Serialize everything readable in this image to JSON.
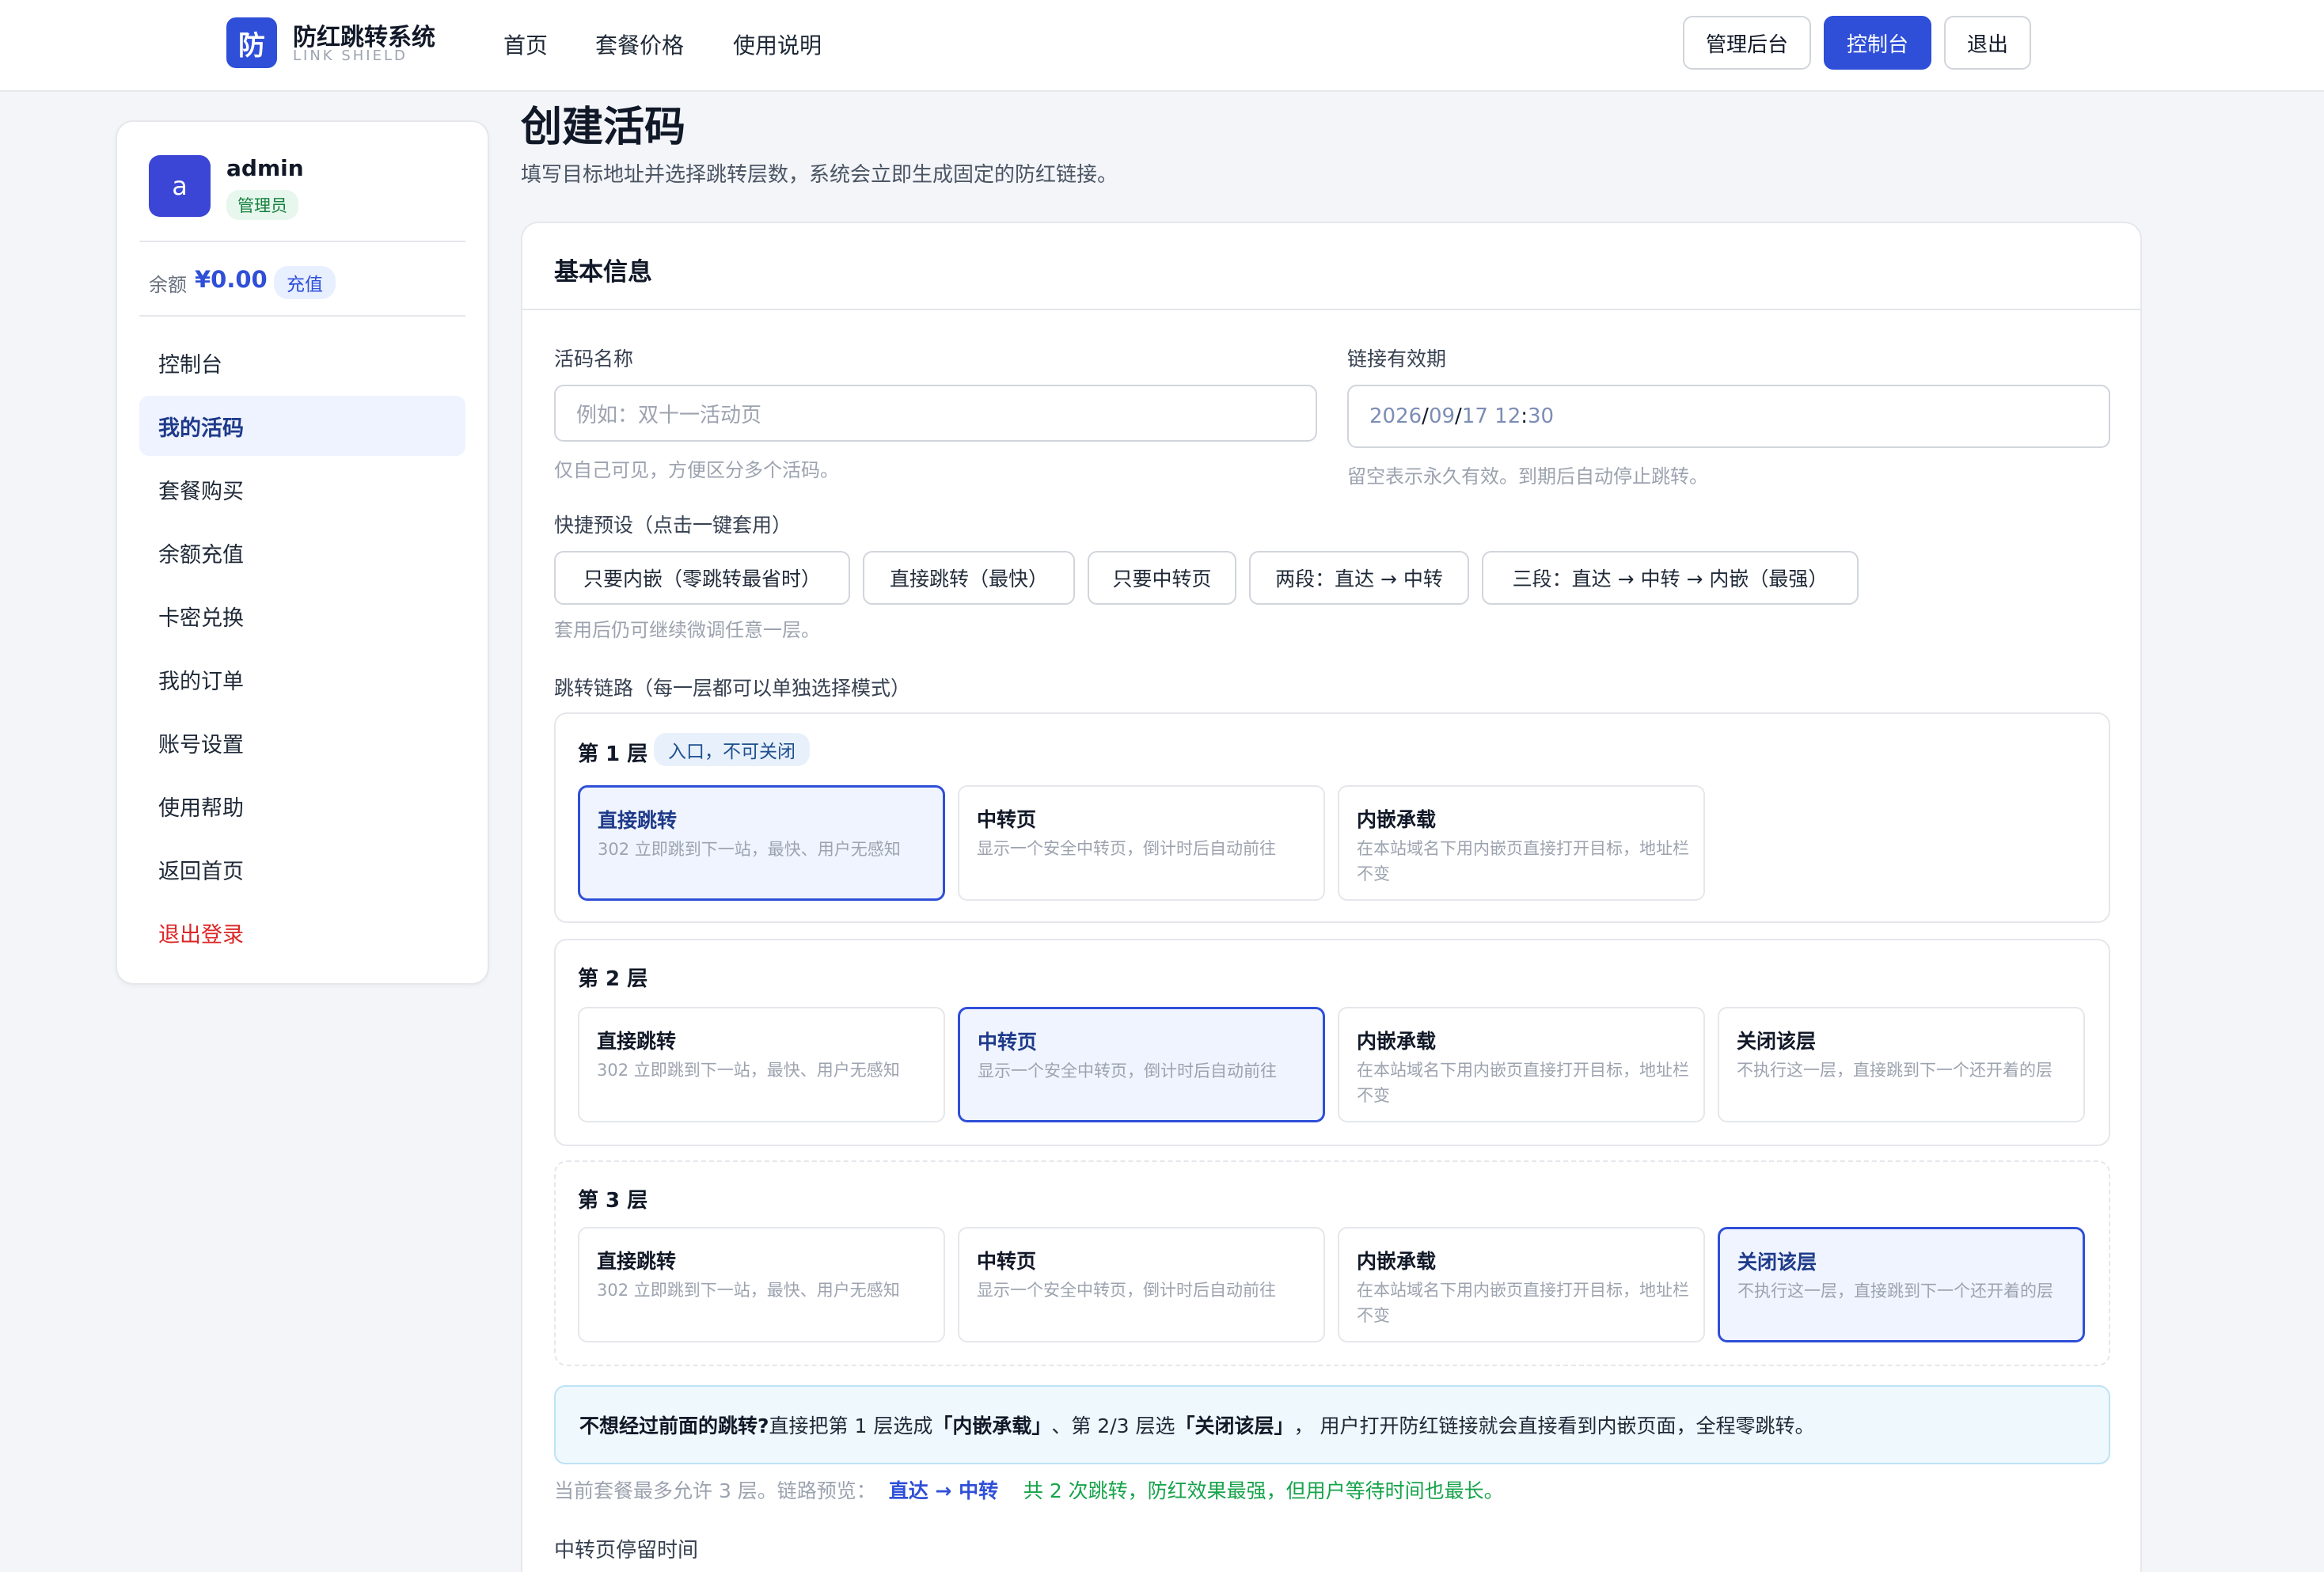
{
  "header": {
    "logo_char": "防",
    "brand_name": "防红跳转系统",
    "brand_sub": "LINK SHIELD",
    "nav": [
      "首页",
      "套餐价格",
      "使用说明"
    ],
    "btn_admin": "管理后台",
    "btn_console": "控制台",
    "btn_logout": "退出"
  },
  "sidebar": {
    "avatar_char": "a",
    "user_name": "admin",
    "role": "管理员",
    "balance_label": "余额",
    "balance_amount": "¥0.00",
    "recharge": "充值",
    "items": [
      "控制台",
      "我的活码",
      "套餐购买",
      "余额充值",
      "卡密兑换",
      "我的订单",
      "账号设置",
      "使用帮助",
      "返回首页",
      "退出登录"
    ]
  },
  "main": {
    "title": "创建活码",
    "subtitle": "填写目标地址并选择跳转层数，系统会立即生成固定的防红链接。",
    "card_title": "基本信息",
    "name_label": "活码名称",
    "name_placeholder": "例如：双十一活动页",
    "name_hint": "仅自己可见，方便区分多个活码。",
    "expiry_label": "链接有效期",
    "expiry_year": "2026",
    "expiry_month": "09",
    "expiry_day": "17",
    "expiry_hour": "12",
    "expiry_minute": "30",
    "expiry_hint": "留空表示永久有效。到期后自动停止跳转。",
    "preset_label": "快捷预设（点击一键套用）",
    "presets": [
      "只要内嵌（零跳转最省时）",
      "直接跳转（最快）",
      "只要中转页",
      "两段：直达 → 中转",
      "三段：直达 → 中转 → 内嵌（最强）"
    ],
    "preset_hint": "套用后仍可继续微调任意一层。",
    "chain_label": "跳转链路（每一层都可以单独选择模式）",
    "layers": [
      {
        "title": "第 1 层",
        "tag": "入口，不可关闭",
        "options": [
          {
            "title": "直接跳转",
            "desc": "302 立即跳到下一站，最快、用户无感知"
          },
          {
            "title": "中转页",
            "desc": "显示一个安全中转页，倒计时后自动前往"
          },
          {
            "title": "内嵌承载",
            "desc": "在本站域名下用内嵌页直接打开目标，地址栏不变"
          }
        ]
      },
      {
        "title": "第 2 层",
        "options": [
          {
            "title": "直接跳转",
            "desc": "302 立即跳到下一站，最快、用户无感知"
          },
          {
            "title": "中转页",
            "desc": "显示一个安全中转页，倒计时后自动前往"
          },
          {
            "title": "内嵌承载",
            "desc": "在本站域名下用内嵌页直接打开目标，地址栏不变"
          },
          {
            "title": "关闭该层",
            "desc": "不执行这一层，直接跳到下一个还开着的层"
          }
        ]
      },
      {
        "title": "第 3 层",
        "options": [
          {
            "title": "直接跳转",
            "desc": "302 立即跳到下一站，最快、用户无感知"
          },
          {
            "title": "中转页",
            "desc": "显示一个安全中转页，倒计时后自动前往"
          },
          {
            "title": "内嵌承载",
            "desc": "在本站域名下用内嵌页直接打开目标，地址栏不变"
          },
          {
            "title": "关闭该层",
            "desc": "不执行这一层，直接跳到下一个还开着的层"
          }
        ]
      }
    ],
    "info_q": "不想经过前面的跳转?",
    "info_1": " 直接把第 1 层选成",
    "info_b1": "「内嵌承载」",
    "info_2": "、第 2/3 层选",
    "info_b2": "「关闭该层」",
    "info_3": "， 用户打开防红链接就会直接看到内嵌页面，全程零跳转。",
    "preview_text": "当前套餐最多允许 3 层。链路预览：",
    "preview_chain": "直达 → 中转",
    "preview_note": "共 2 次跳转，防红效果最强，但用户等待时间也最长。",
    "stay_label": "中转页停留时间"
  },
  "colors": {
    "accent": "#2f4fd8",
    "success": "#16a34a",
    "danger": "#dc2626",
    "info_bg": "#eef8fd"
  }
}
